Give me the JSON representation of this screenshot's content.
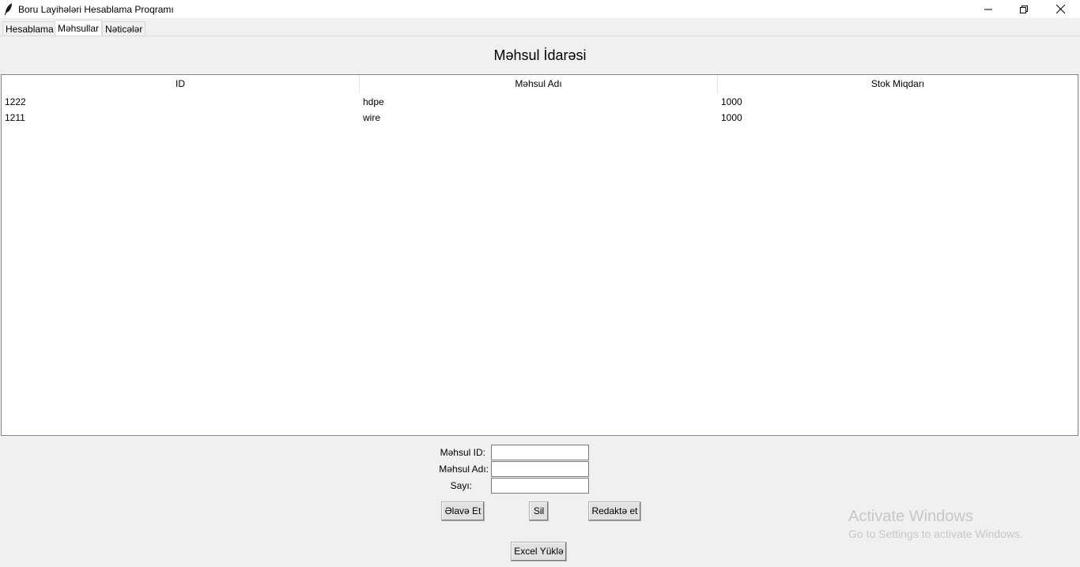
{
  "window": {
    "title": "Boru Layihələri Hesablama Proqramı"
  },
  "tabs": [
    {
      "label": "Hesablama",
      "active": false
    },
    {
      "label": "Məhsullar",
      "active": true
    },
    {
      "label": "Nəticələr",
      "active": false
    }
  ],
  "page": {
    "heading": "Məhsul İdarəsi"
  },
  "table": {
    "columns": [
      "ID",
      "Məhsul Adı",
      "Stok Miqdarı"
    ],
    "rows": [
      [
        "1222",
        "hdpe",
        "1000"
      ],
      [
        "1211",
        "wire",
        "1000"
      ]
    ]
  },
  "form": {
    "id_label": "Məhsul ID:",
    "id_value": "",
    "name_label": "Məhsul Adı:",
    "name_value": "",
    "qty_label": "Sayı:",
    "qty_value": ""
  },
  "buttons": {
    "add": "Əlavə Et",
    "delete": "Sil",
    "edit": "Redaktə et",
    "excel": "Excel Yüklə"
  },
  "watermark": {
    "line1": "Activate Windows",
    "line2": "Go to Settings to activate Windows."
  }
}
